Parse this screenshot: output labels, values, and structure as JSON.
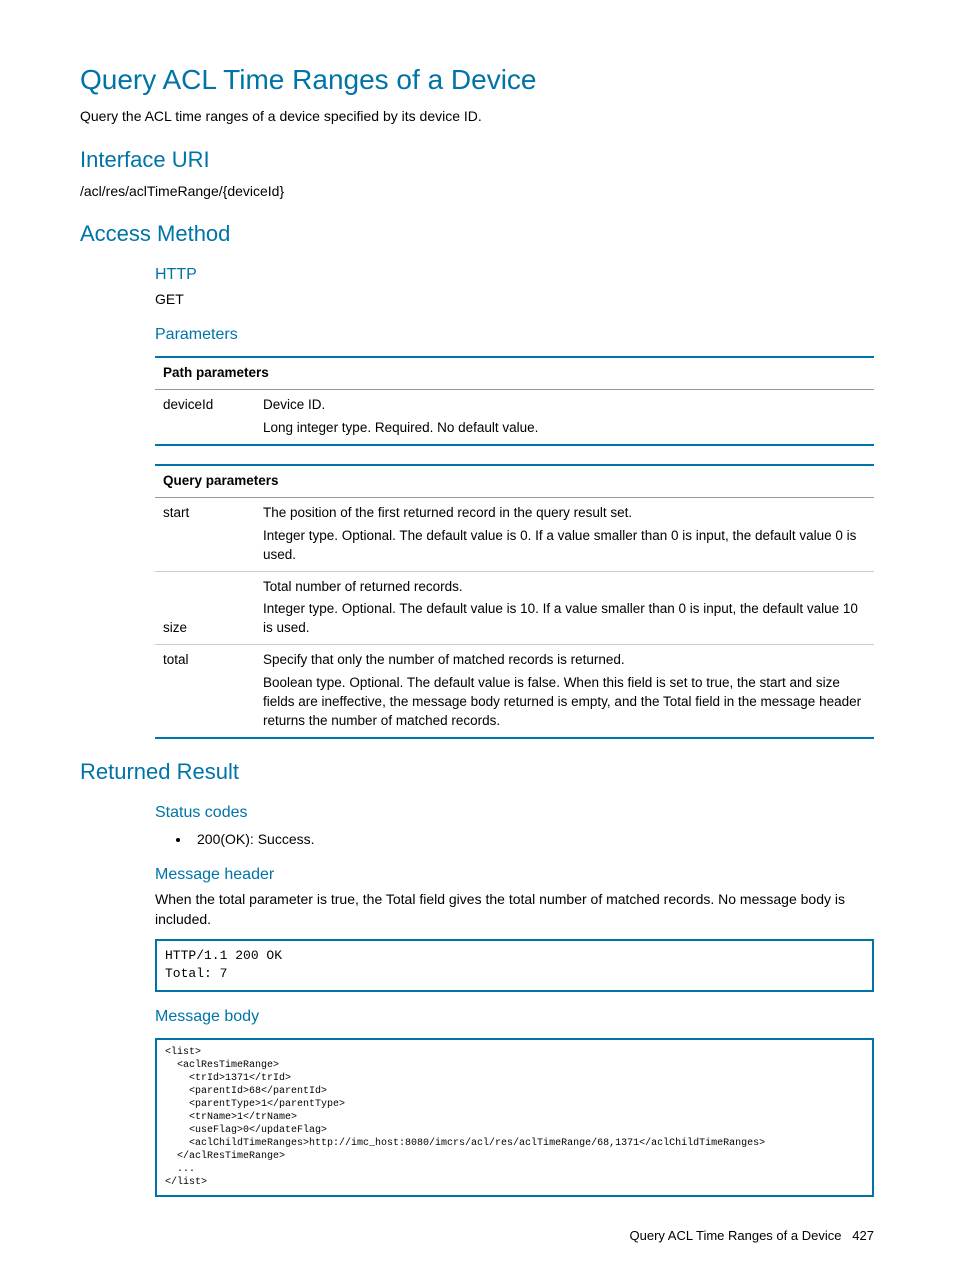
{
  "title": "Query ACL Time Ranges of a Device",
  "intro": "Query the ACL time ranges of a device specified by its device ID.",
  "sections": {
    "interface_uri": {
      "heading": "Interface URI",
      "value": "/acl/res/aclTimeRange/{deviceId}"
    },
    "access_method": {
      "heading": "Access Method",
      "http_heading": "HTTP",
      "http_value": "GET",
      "params_heading": "Parameters",
      "path_table": {
        "header": "Path parameters",
        "rows": [
          {
            "name": "deviceId",
            "desc1": "Device ID.",
            "desc2": "Long integer type. Required. No default value."
          }
        ]
      },
      "query_table": {
        "header": "Query parameters",
        "rows": [
          {
            "name": "start",
            "desc1": "The position of the first returned record in the query result set.",
            "desc2": "Integer type. Optional. The default value is 0. If a value smaller than 0 is input, the default value 0 is used."
          },
          {
            "name": "size",
            "desc1": "Total number of returned records.",
            "desc2": "Integer type. Optional. The default value is 10. If a value smaller than 0 is input, the default value 10 is used."
          },
          {
            "name": "total",
            "desc1": "Specify that only the number of matched records is returned.",
            "desc2": "Boolean type. Optional. The default value is false. When this field is set to true, the start and size fields are ineffective, the message body returned is empty, and the Total field in the message header returns the number of matched records."
          }
        ]
      }
    },
    "returned_result": {
      "heading": "Returned Result",
      "status_codes_heading": "Status codes",
      "status_codes": [
        "200(OK): Success."
      ],
      "message_header_heading": "Message header",
      "message_header_text": "When the total parameter is true, the Total field gives the total number of matched records. No message body is included.",
      "message_header_code": "HTTP/1.1 200 OK\nTotal: 7",
      "message_body_heading": "Message body",
      "message_body_code": "<list>\n  <aclResTimeRange>\n    <trId>1371</trId>\n    <parentId>68</parentId>\n    <parentType>1</parentType>\n    <trName>1</trName>\n    <useFlag>0</updateFlag>\n    <aclChildTimeRanges>http://imc_host:8080/imcrs/acl/res/aclTimeRange/68,1371</aclChildTimeRanges>\n  </aclResTimeRange>\n  ...\n</list>"
    }
  },
  "footer": {
    "title": "Query ACL Time Ranges of a Device",
    "page": "427"
  }
}
